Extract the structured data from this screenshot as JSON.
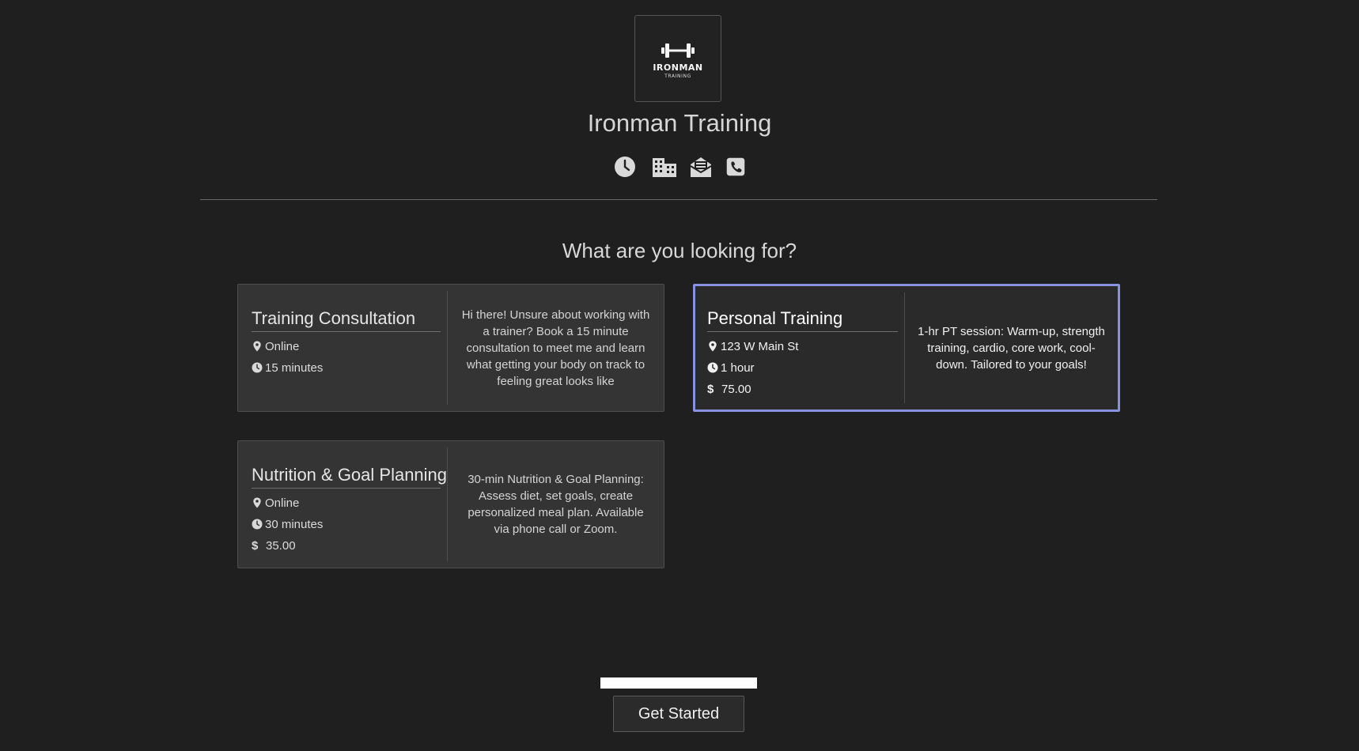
{
  "business": {
    "logo_word": "IRONMAN",
    "logo_sub": "TRAINING",
    "name": "Ironman Training",
    "icons": [
      "clock-icon",
      "building-icon",
      "envelope-icon",
      "phone-icon"
    ]
  },
  "prompt": "What are you looking for?",
  "services": [
    {
      "title": "Training Consultation",
      "location": "Online",
      "duration": "15 minutes",
      "price": null,
      "description": "Hi there! Unsure about working with a trainer? Book a 15 minute consultation to meet me and learn what getting your body on track to feeling great looks like",
      "selected": false
    },
    {
      "title": "Personal Training",
      "location": "123 W Main St",
      "duration": "1 hour",
      "price": "75.00",
      "description": "1-hr PT session: Warm-up, strength training, cardio, core work, cool-down. Tailored to your goals!",
      "selected": true
    },
    {
      "title": "Nutrition & Goal Planning",
      "location": "Online",
      "duration": "30 minutes",
      "price": "35.00",
      "description": "30-min Nutrition & Goal Planning: Assess diet, set goals, create personalized meal plan. Available via phone call or Zoom.",
      "selected": false
    }
  ],
  "footer": {
    "cta_label": "Get Started"
  },
  "colors": {
    "background": "#1f1f1f",
    "card": "#343434",
    "selected_border": "#8891e0"
  }
}
